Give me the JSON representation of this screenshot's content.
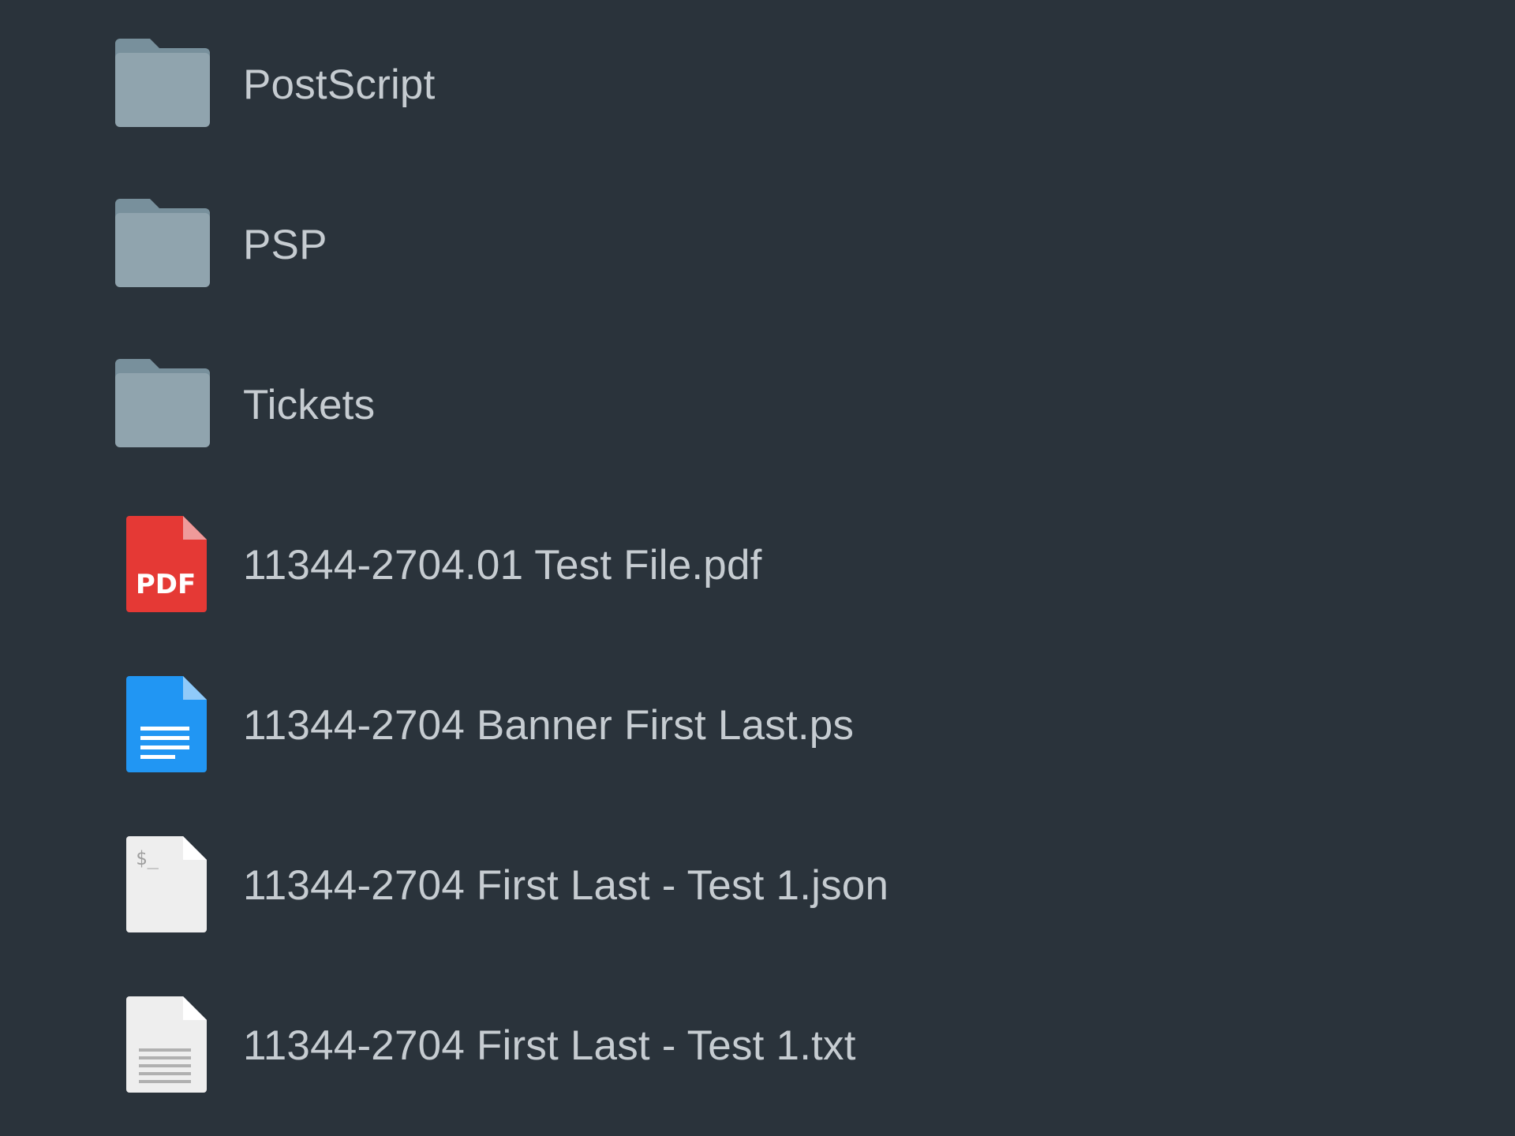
{
  "files": [
    {
      "name": "PostScript",
      "icon": "folder-icon",
      "color": "#90a4ae"
    },
    {
      "name": "PSP",
      "icon": "folder-icon",
      "color": "#90a4ae"
    },
    {
      "name": "Tickets",
      "icon": "folder-icon",
      "color": "#90a4ae"
    },
    {
      "name": "11344-2704.01 Test File.pdf",
      "icon": "pdf-file-icon",
      "icon_text": "PDF",
      "color": "#e53935"
    },
    {
      "name": "11344-2704 Banner First Last.ps",
      "icon": "document-file-icon",
      "color": "#2196f3"
    },
    {
      "name": "11344-2704 First Last - Test 1.json",
      "icon": "script-file-icon",
      "icon_text": "$_",
      "color": "#eeeeee"
    },
    {
      "name": "11344-2704 First Last - Test 1.txt",
      "icon": "text-file-icon",
      "color": "#eeeeee"
    }
  ]
}
